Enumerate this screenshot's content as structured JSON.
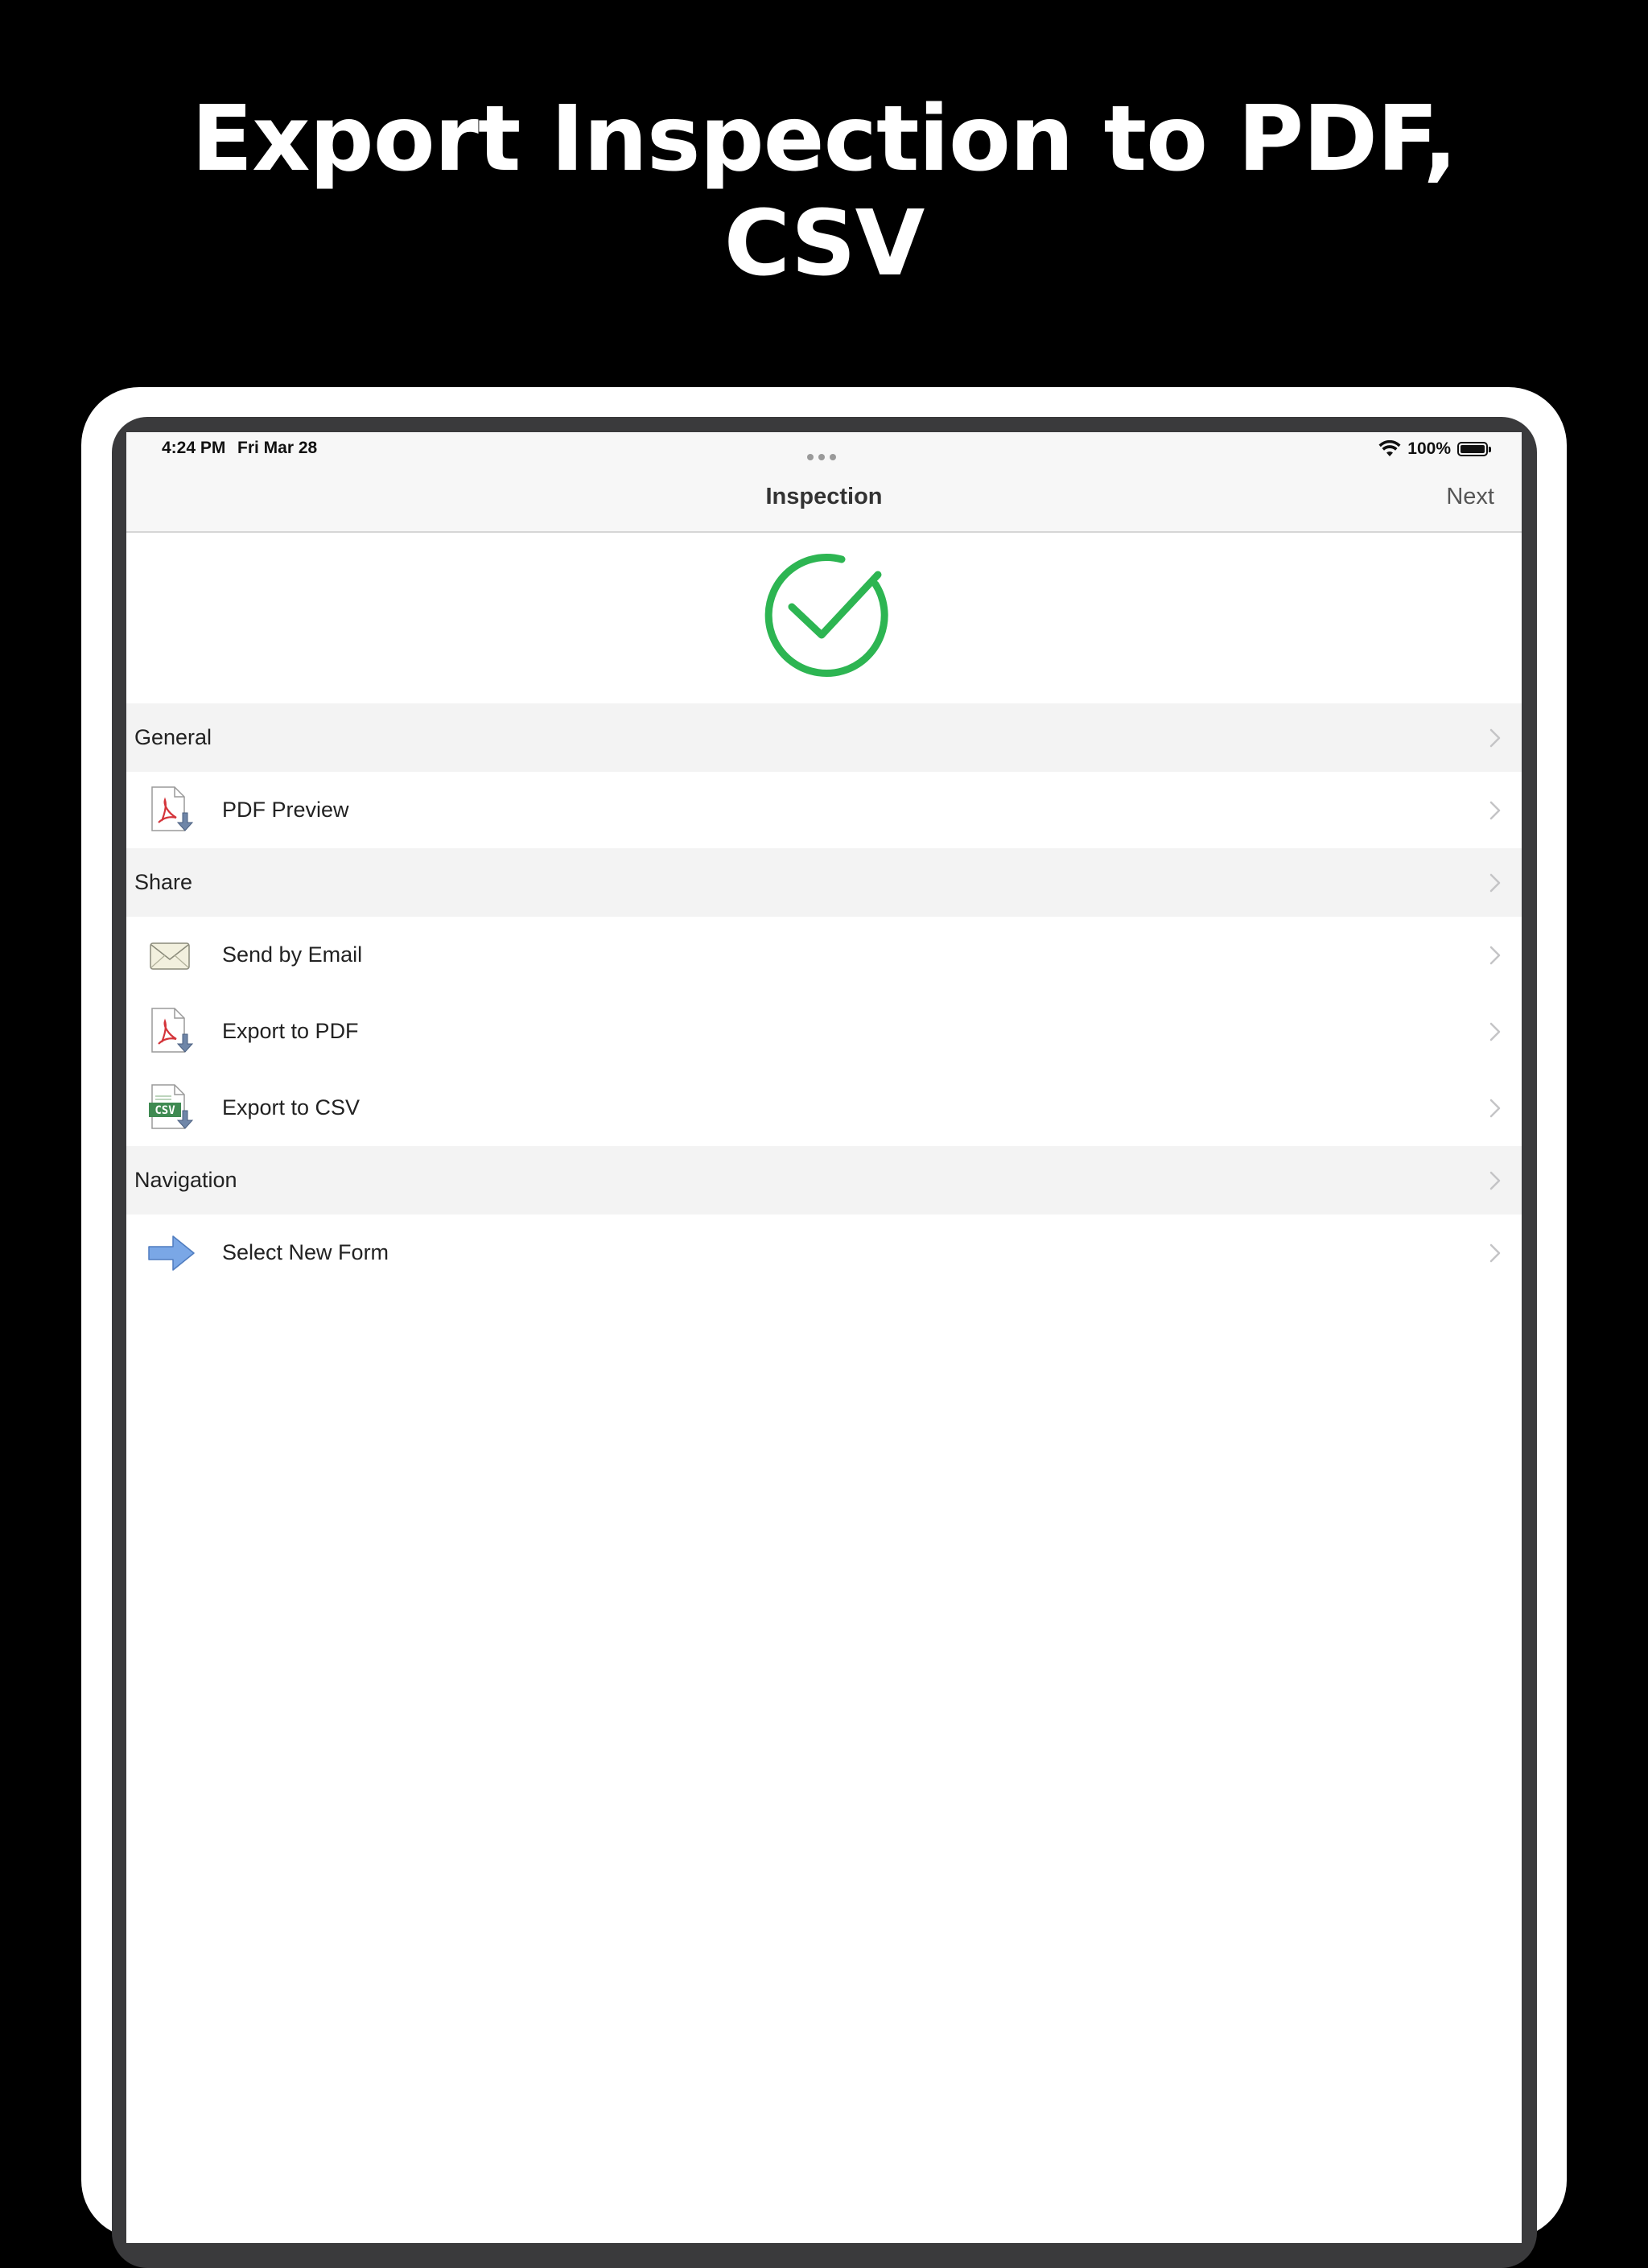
{
  "headline": {
    "line1": "Export Inspection to PDF,",
    "line2": "CSV"
  },
  "status_bar": {
    "time": "4:24 PM",
    "date": "Fri Mar 28",
    "battery": "100%"
  },
  "nav_bar": {
    "title": "Inspection",
    "next_label": "Next"
  },
  "sections": {
    "general": {
      "label": "General",
      "items": [
        {
          "label": "PDF Preview",
          "icon": "pdf-download-icon"
        }
      ]
    },
    "share": {
      "label": "Share",
      "items": [
        {
          "label": "Send by Email",
          "icon": "envelope-icon"
        },
        {
          "label": "Export to PDF",
          "icon": "pdf-download-icon"
        },
        {
          "label": "Export to CSV",
          "icon": "csv-download-icon"
        }
      ]
    },
    "navigation": {
      "label": "Navigation",
      "items": [
        {
          "label": "Select New Form",
          "icon": "right-arrow-icon"
        }
      ]
    }
  },
  "icons": {
    "csv_badge": "CSV"
  },
  "colors": {
    "check_green": "#2db552",
    "pdf_red": "#d4343a",
    "arrow_blue": "#7aa7e6"
  }
}
